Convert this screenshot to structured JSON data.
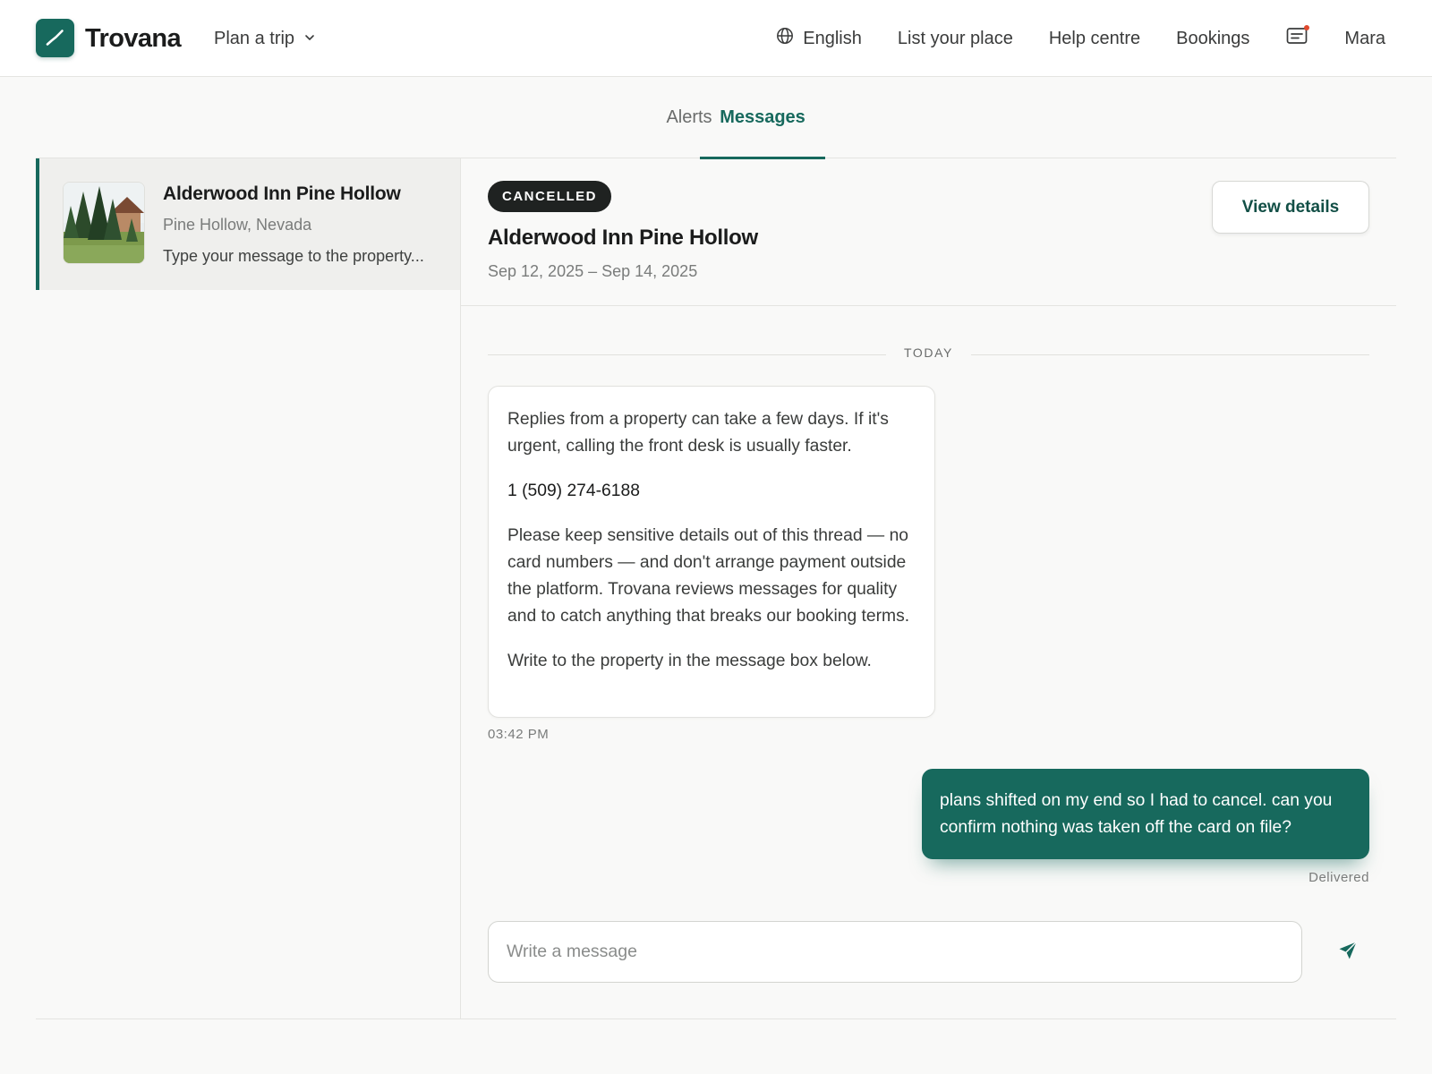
{
  "header": {
    "brand": "Trovana",
    "plan_trip": "Plan a trip",
    "language": "English",
    "list_place": "List your place",
    "help": "Help centre",
    "bookings": "Bookings",
    "user": "Mara",
    "has_notification": true
  },
  "tabs": [
    {
      "label": "Alerts",
      "active": false
    },
    {
      "label": "Messages",
      "active": true
    }
  ],
  "conversations": [
    {
      "title": "Alderwood Inn Pine Hollow",
      "location": "Pine Hollow, Nevada",
      "preview": "Type your message to the property...",
      "selected": true
    }
  ],
  "thread": {
    "status": "CANCELLED",
    "title": "Alderwood Inn Pine Hollow",
    "dates": "Sep 12, 2025 – Sep 14, 2025",
    "view_details": "View details",
    "day_label": "TODAY",
    "system_message": {
      "p1": "Replies from a property can take a few days. If it's urgent, calling the front desk is usually faster.",
      "phone": "1 (509) 274-6188",
      "p2": "Please keep sensitive details out of this thread — no card numbers — and don't arrange payment outside the platform. Trovana reviews messages for quality and to catch anything that breaks our booking terms.",
      "p3": "Write to the property in the message box below.",
      "time": "03:42 PM"
    },
    "user_message": {
      "text": "plans shifted on my end so I had to cancel. can you confirm nothing was taken off the card on file?",
      "status": "Delivered"
    },
    "composer": {
      "placeholder": "Write a message",
      "value": ""
    }
  },
  "colors": {
    "accent": "#17695d",
    "badge_bg": "#1f2221",
    "notification": "#e0492e"
  },
  "icons": {
    "logo": "trend-line-icon",
    "plan_trip": "chevron-down-icon",
    "language": "globe-icon",
    "inbox": "message-icon",
    "send": "send-icon"
  }
}
